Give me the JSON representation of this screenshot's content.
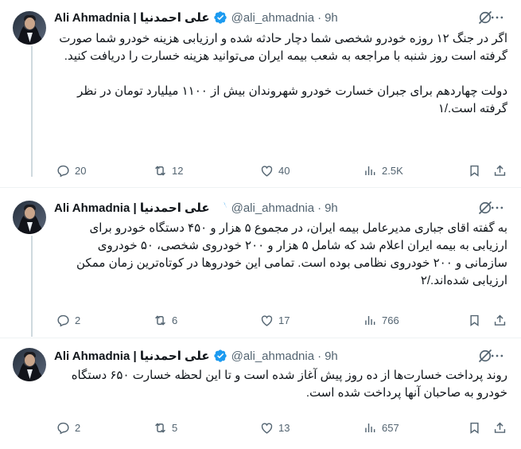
{
  "thread": {
    "tweets": [
      {
        "display_name": "Ali Ahmadnia | علی احمدنیا",
        "handle": "@ali_ahmadnia",
        "separator": "·",
        "time": "9h",
        "text": "اگر در جنگ ۱۲ روزه خودرو شخصی شما دچار حادثه شده و ارزیابی هزینه خودرو شما صورت گرفته است روز شنبه با مراجعه به شعب بیمه ایران می‌توانید هزینه خسارت را دریافت کنید.\n\nدولت چهاردهم برای جبران خسارت خودرو شهروندان بیش از ۱۱۰۰ میلیارد تومان در نظر گرفته است./۱",
        "replies": "20",
        "reposts": "12",
        "likes": "40",
        "views": "2.5K"
      },
      {
        "display_name": "Ali Ahmadnia | علی احمدنیا",
        "handle": "@ali_ahmadnia",
        "separator": "·",
        "time": "9h",
        "text": "به گفته اقای جباری مدیرعامل بیمه ایران، در مجموع ۵ هزار و ۴۵۰ دستگاه خودرو برای ارزیابی به بیمه ایران اعلام شد که شامل ۵ هزار و ۲۰۰ خودروی شخصی، ۵۰ خودروی سازمانی و ۲۰۰ خودروی نظامی بوده است. تمامی این خودروها در کوتاه‌ترین زمان ممکن ارزیابی شده‌اند./۲",
        "replies": "2",
        "reposts": "6",
        "likes": "17",
        "views": "766"
      },
      {
        "display_name": "Ali Ahmadnia | علی احمدنیا",
        "handle": "@ali_ahmadnia",
        "separator": "·",
        "time": "9h",
        "text": "روند پرداخت خسارت‌ها از ده روز پیش آغاز شده است و تا این لحظه خسارت ۶۵۰ دستگاه خودرو به صاحبان آنها پرداخت شده است.",
        "replies": "2",
        "reposts": "5",
        "likes": "13",
        "views": "657"
      }
    ]
  },
  "icons": {
    "verified": "verified-badge-icon",
    "grok": "grok-icon",
    "more": "more-icon",
    "reply": "reply-icon",
    "repost": "repost-icon",
    "like": "like-icon",
    "views": "views-icon",
    "bookmark": "bookmark-icon",
    "share": "share-icon"
  },
  "colors": {
    "verified": "#1d9bf0",
    "secondary_text": "#536471",
    "divider": "#eff3f4"
  }
}
